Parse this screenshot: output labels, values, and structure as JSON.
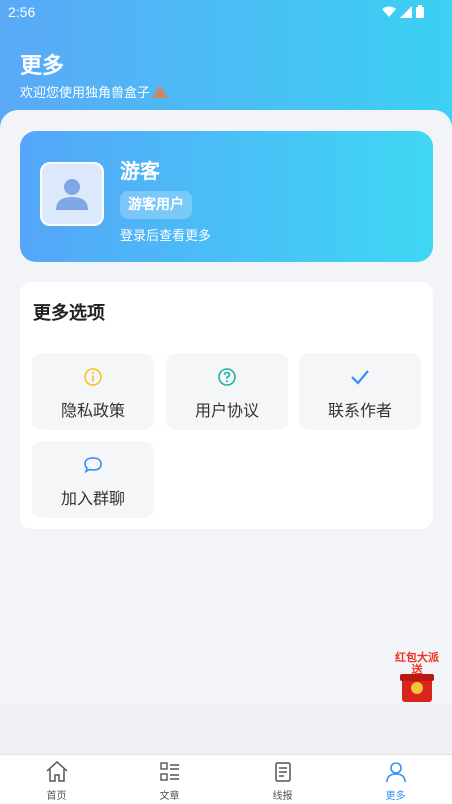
{
  "status_bar": {
    "time": "2:56"
  },
  "header": {
    "title": "更多",
    "subtitle": "欢迎您使用独角兽盒子"
  },
  "profile": {
    "name": "游客",
    "badge": "游客用户",
    "hint": "登录后查看更多"
  },
  "options": {
    "title": "更多选项",
    "items": [
      {
        "label": "隐私政策",
        "icon": "info-icon",
        "color": "#f2c41a"
      },
      {
        "label": "用户协议",
        "icon": "help-icon",
        "color": "#19b3a8"
      },
      {
        "label": "联系作者",
        "icon": "check-icon",
        "color": "#3a8ef5"
      },
      {
        "label": "加入群聊",
        "icon": "chat-bubble-icon",
        "color": "#3a8ef5"
      }
    ]
  },
  "floating_ad": {
    "text": "红包大派送"
  },
  "tabbar": {
    "items": [
      {
        "label": "首页",
        "icon": "home-icon"
      },
      {
        "label": "文章",
        "icon": "list-icon"
      },
      {
        "label": "线报",
        "icon": "document-icon"
      },
      {
        "label": "更多",
        "icon": "user-icon",
        "active": true
      }
    ]
  },
  "colors": {
    "accent": "#3a8ef5",
    "gradient_start": "#55a6f8",
    "gradient_end": "#3fd7f4"
  }
}
